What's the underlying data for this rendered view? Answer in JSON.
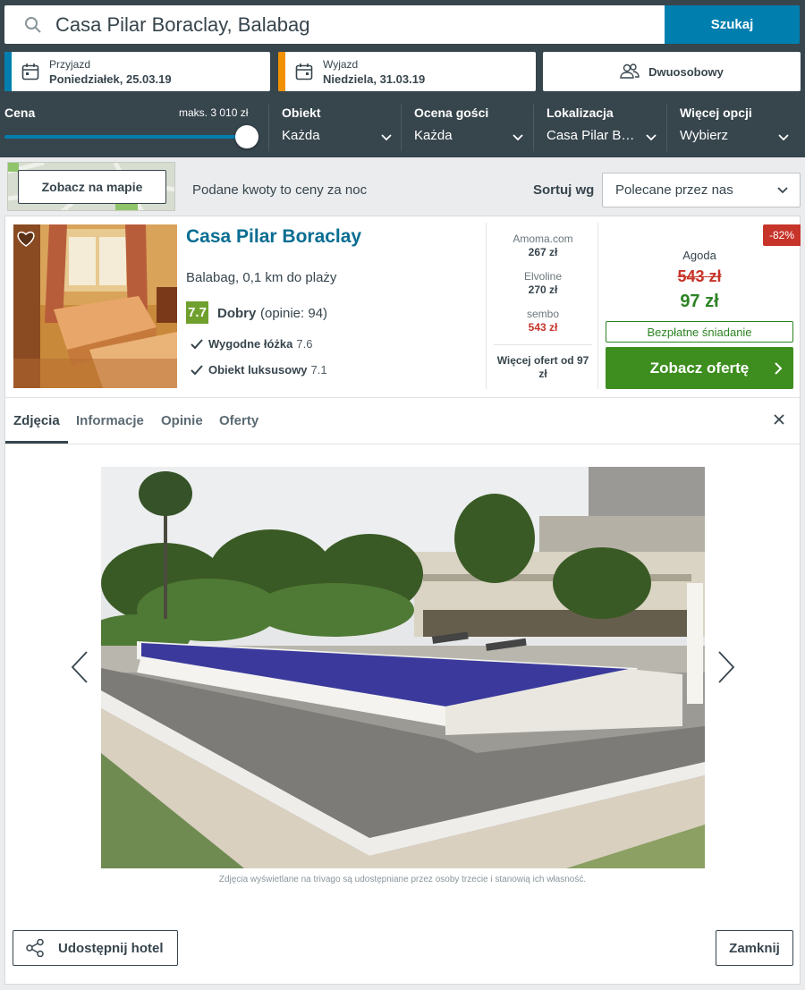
{
  "search": {
    "query": "Casa Pilar Boraclay, Balabag",
    "button": "Szukaj"
  },
  "dates": {
    "checkin_label": "Przyjazd",
    "checkin_value": "Poniedziałek, 25.03.19",
    "checkout_label": "Wyjazd",
    "checkout_value": "Niedziela, 31.03.19"
  },
  "room": {
    "label": "Dwuosobowy"
  },
  "filters": {
    "price_label": "Cena",
    "price_max": "maks. 3 010 zł",
    "price_level_pct": 100,
    "property_label": "Obiekt",
    "property_value": "Każda",
    "rating_label": "Ocena gości",
    "rating_value": "Każda",
    "location_label": "Lokalizacja",
    "location_value": "Casa Pilar B…",
    "more_label": "Więcej opcji",
    "more_value": "Wybierz"
  },
  "toolbar": {
    "map_button": "Zobacz na mapie",
    "price_note": "Podane kwoty to ceny za noc",
    "sort_label": "Sortuj wg",
    "sort_value": "Polecane przez nas"
  },
  "hotel": {
    "name": "Casa Pilar Boraclay",
    "location": "Balabag, 0,1 km do plaży",
    "rating_score": "7.7",
    "rating_word": "Dobry",
    "rating_count": "(opinie: 94)",
    "features": [
      {
        "name": "Wygodne łóżka",
        "score": "7.6"
      },
      {
        "name": "Obiekt luksusowy",
        "score": "7.1"
      }
    ],
    "offers": [
      {
        "site": "Amoma.com",
        "price": "267 zł"
      },
      {
        "site": "Elvoline",
        "price": "270 zł"
      },
      {
        "site": "sembo",
        "price": "543 zł"
      }
    ],
    "more_offers": "Więcej ofert od 97 zł",
    "discount": "-82%",
    "deal_site": "Agoda",
    "old_price": "543 zł",
    "new_price": "97 zł",
    "breakfast": "Bezpłatne śniadanie",
    "deal_button": "Zobacz ofertę"
  },
  "tabs": [
    "Zdjęcia",
    "Informacje",
    "Opinie",
    "Oferty"
  ],
  "gallery": {
    "credit": "Zdjęcia wyświetlane na trivago są udostępniane przez osoby trzecie i stanowią ich własność."
  },
  "footer": {
    "share_button": "Udostępnij hotel",
    "close_button": "Zamknij"
  },
  "colors": {
    "header": "#37454d",
    "accent_blue": "#007faf",
    "deal_green": "#3e8e1f",
    "alert_red": "#c7342a",
    "checkin_strip": "#007faf",
    "checkout_strip": "#f29100"
  }
}
